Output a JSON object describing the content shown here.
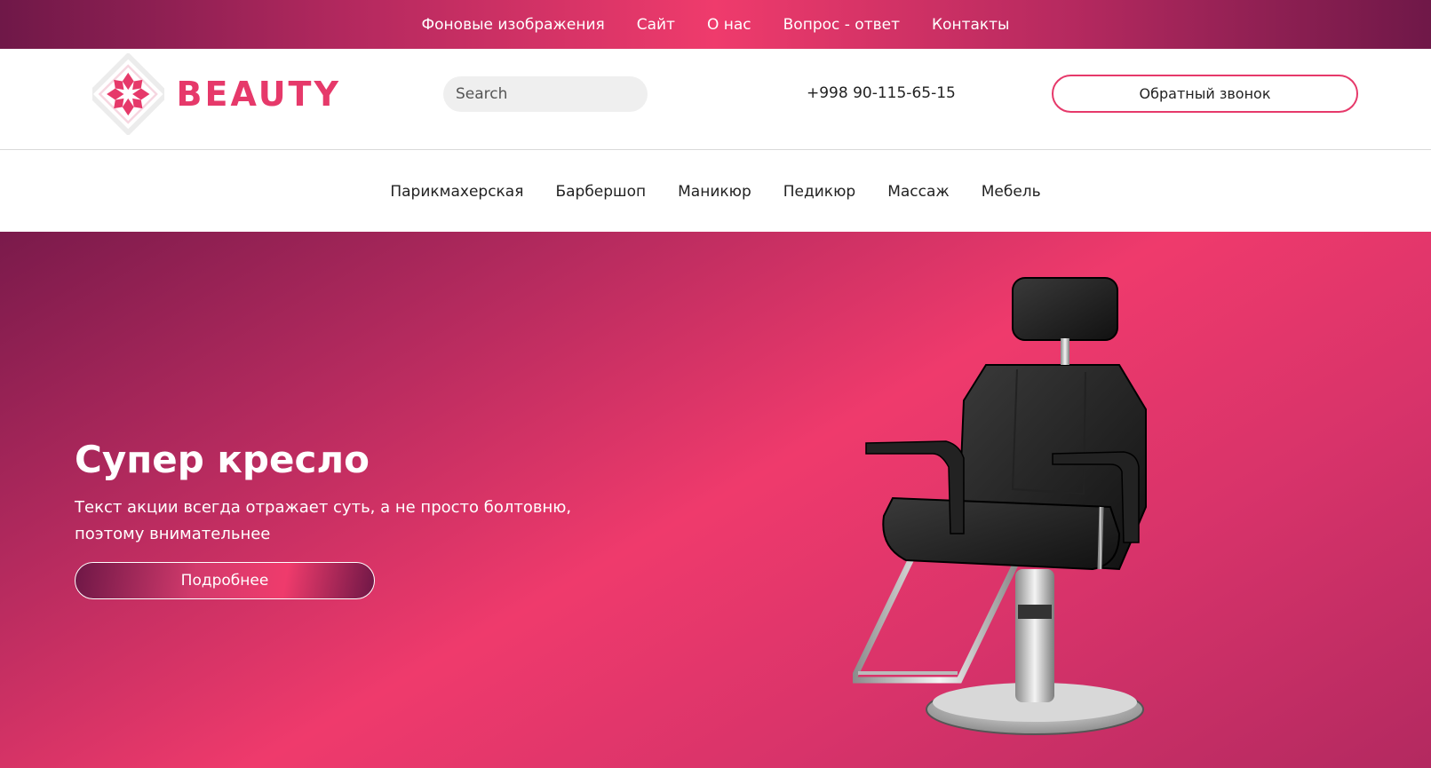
{
  "topnav": {
    "items": [
      "Фоновые изображения",
      "Сайт",
      "О нас",
      "Вопрос - ответ",
      "Контакты"
    ]
  },
  "header": {
    "logo_text": "BEAUTY",
    "search_placeholder": "Search",
    "phone": "+998 90-115-65-15",
    "callback_label": "Обратный звонок"
  },
  "categories": {
    "items": [
      "Парикмахерская",
      "Барбершоп",
      "Маникюр",
      "Педикюр",
      "Массаж",
      "Мебель"
    ]
  },
  "hero": {
    "title": "Супер кресло",
    "text": "Текст акции всегда отражает суть, а не просто болтовню, поэтому внимательнее",
    "button_label": "Подробнее",
    "image": "barber-chair-image"
  },
  "colors": {
    "accent": "#e6396a",
    "dark_pink": "#6f1848"
  }
}
